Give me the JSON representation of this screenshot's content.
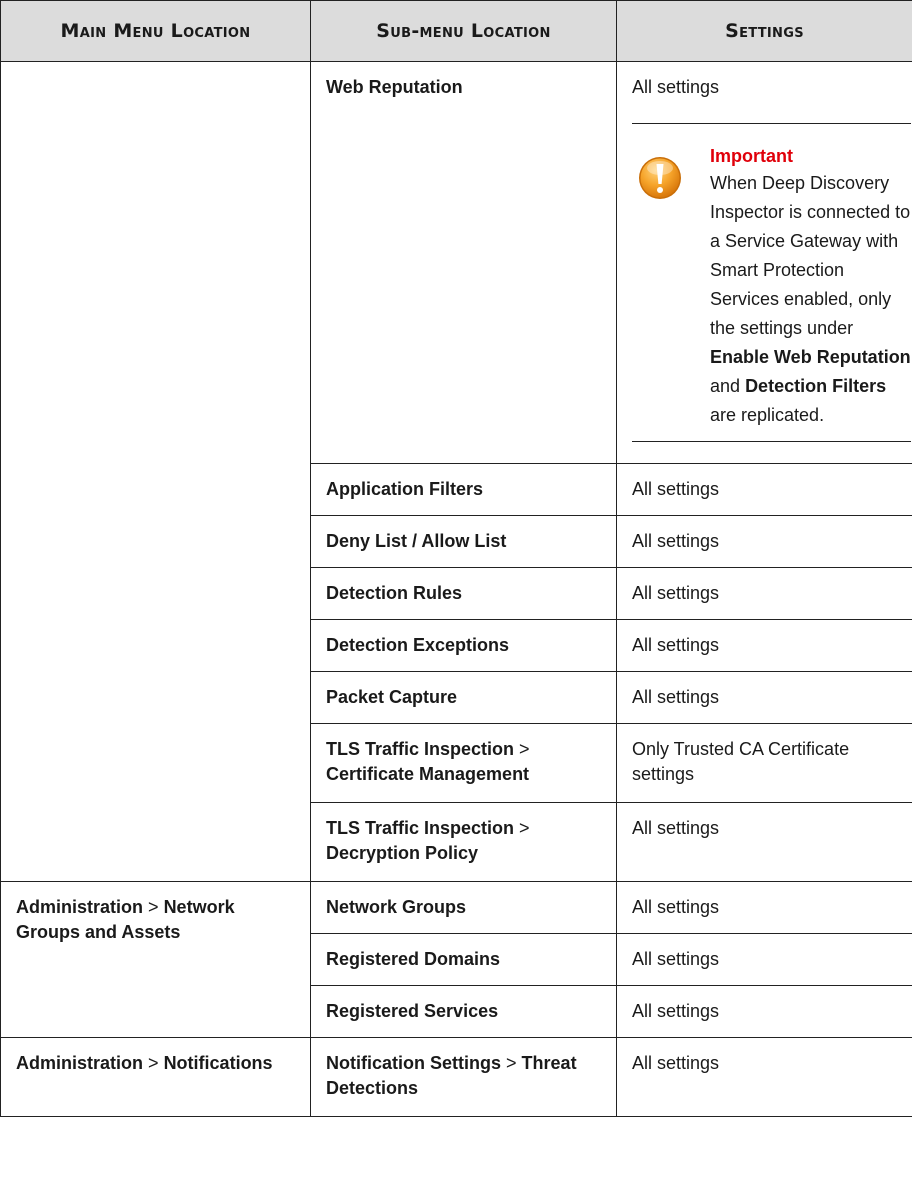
{
  "headers": {
    "main": "Main Menu Location",
    "sub": "Sub-menu Location",
    "settings": "Settings"
  },
  "web_reputation": {
    "sub": "Web Reputation",
    "settings": "All settings",
    "note": {
      "icon": "warning-icon",
      "title": "Important",
      "text_1": "When Deep Discovery Inspector is connected to a Service Gateway with Smart Protection Services enabled, only the settings under",
      "bold_1": "Enable Web Reputation",
      "text_2": "and",
      "bold_2": "Detection Filters",
      "text_3": "are replicated."
    }
  },
  "rows_group1": [
    {
      "sub": "Application Filters",
      "settings": "All settings"
    },
    {
      "sub": "Deny List / Allow List",
      "settings": "All settings"
    },
    {
      "sub": "Detection Rules",
      "settings": "All settings"
    },
    {
      "sub": "Detection Exceptions",
      "settings": "All settings"
    },
    {
      "sub": "Packet Capture",
      "settings": "All settings"
    }
  ],
  "tls_cert": {
    "sub_a": "TLS Traffic Inspection",
    "sep": ">",
    "sub_b": "Certificate Management",
    "settings": "Only Trusted CA Certificate settings"
  },
  "tls_decrypt": {
    "sub_a": "TLS Traffic Inspection",
    "sep": ">",
    "sub_b": "Decryption Policy",
    "settings": "All settings"
  },
  "network": {
    "main_a": "Administration",
    "sep": ">",
    "main_b": "Network Groups and Assets",
    "rows": [
      {
        "sub": "Network Groups",
        "settings": "All settings"
      },
      {
        "sub": "Registered Domains",
        "settings": "All settings"
      },
      {
        "sub": "Registered Services",
        "settings": "All settings"
      }
    ]
  },
  "notifications": {
    "main_a": "Administration",
    "sep": ">",
    "main_b": "Notifications",
    "sub_a": "Notification Settings",
    "sub_sep": ">",
    "sub_b": "Threat Detections",
    "settings": "All settings"
  },
  "colors": {
    "header_bg": "#dcdcdc",
    "important": "#e0000a",
    "icon_orange": "#f39a1b"
  }
}
